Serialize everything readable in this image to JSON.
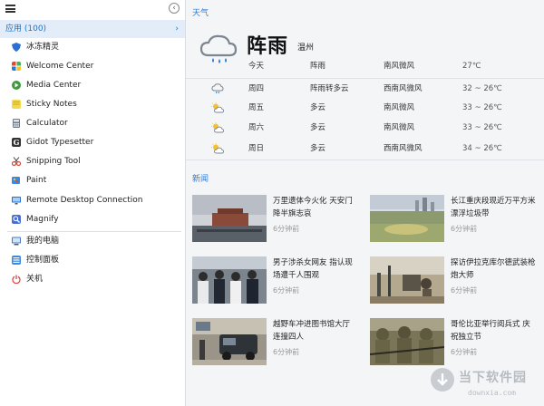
{
  "menu": {
    "apps_header": "应用 (100)",
    "items": [
      {
        "label": "冰冻精灵",
        "icon": "shield-icon",
        "color": "#2a6fd1"
      },
      {
        "label": "Welcome Center",
        "icon": "windows-icon",
        "color": "#3a7fd8"
      },
      {
        "label": "Media Center",
        "icon": "media-center-icon",
        "color": "#3e9a3e"
      },
      {
        "label": "Sticky Notes",
        "icon": "sticky-notes-icon",
        "color": "#e8c840"
      },
      {
        "label": "Calculator",
        "icon": "calculator-icon",
        "color": "#6c7a89"
      },
      {
        "label": "Gidot Typesetter",
        "icon": "typesetter-icon",
        "color": "#333333"
      },
      {
        "label": "Snipping Tool",
        "icon": "scissors-icon",
        "color": "#d04a3a"
      },
      {
        "label": "Paint",
        "icon": "paint-icon",
        "color": "#3a8ae0"
      },
      {
        "label": "Remote Desktop Connection",
        "icon": "remote-desktop-icon",
        "color": "#2a6fd1"
      },
      {
        "label": "Magnify",
        "icon": "magnify-icon",
        "color": "#4a6ed0"
      }
    ],
    "system_items": [
      {
        "label": "我的电脑",
        "icon": "computer-icon",
        "color": "#4a78c0"
      },
      {
        "label": "控制面板",
        "icon": "control-panel-icon",
        "color": "#3a8ae0"
      },
      {
        "label": "关机",
        "icon": "power-icon",
        "color": "#e04040"
      }
    ]
  },
  "weather": {
    "title": "天气",
    "condition": "阵雨",
    "city": "温州",
    "rows": [
      {
        "day": "今天",
        "condition": "阵雨",
        "wind": "南风微风",
        "temp": "27℃",
        "icon": "none"
      },
      {
        "day": "周四",
        "condition": "阵雨转多云",
        "wind": "西南风微风",
        "temp": "32 ~ 26℃",
        "icon": "rain-cloud-icon"
      },
      {
        "day": "周五",
        "condition": "多云",
        "wind": "南风微风",
        "temp": "33 ~ 26℃",
        "icon": "partly-cloudy-icon"
      },
      {
        "day": "周六",
        "condition": "多云",
        "wind": "南风微风",
        "temp": "33 ~ 26℃",
        "icon": "partly-cloudy-icon"
      },
      {
        "day": "周日",
        "condition": "多云",
        "wind": "西南风微风",
        "temp": "34 ~ 26℃",
        "icon": "partly-cloudy-icon"
      }
    ]
  },
  "news": {
    "title": "新闻",
    "items": [
      {
        "headline": "万里遗体今火化 天安门降半旗志哀",
        "time": "6分钟前"
      },
      {
        "headline": "长江重庆段现近万平方米漂浮垃圾带",
        "time": "6分钟前"
      },
      {
        "headline": "男子涉杀女网友 指认现场遭千人围观",
        "time": "6分钟前"
      },
      {
        "headline": "探访伊拉克库尔德武装枪炮大师",
        "time": "6分钟前"
      },
      {
        "headline": "越野车冲进图书馆大厅 连撞四人",
        "time": "6分钟前"
      },
      {
        "headline": "哥伦比亚举行阅兵式 庆祝独立节",
        "time": "6分钟前"
      }
    ]
  },
  "watermark": {
    "text": "当下软件园",
    "url": "downxia.com"
  },
  "colors": {
    "accent": "#2a7ad8",
    "apps_header_bg": "#e3edfa"
  }
}
